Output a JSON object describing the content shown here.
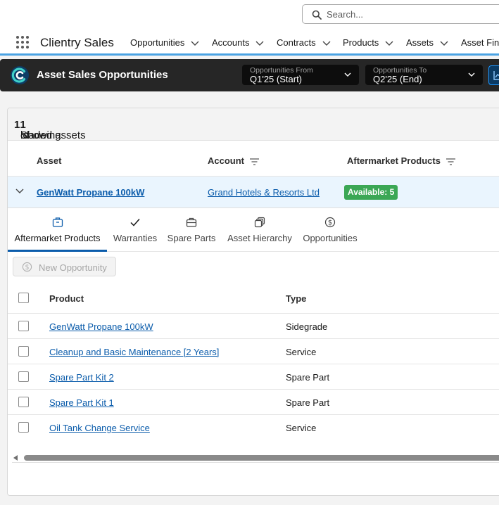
{
  "search": {
    "placeholder": "Search..."
  },
  "app": {
    "name": "Clientry Sales"
  },
  "nav": {
    "items": [
      {
        "label": "Opportunities"
      },
      {
        "label": "Accounts"
      },
      {
        "label": "Contracts"
      },
      {
        "label": "Products"
      },
      {
        "label": "Assets"
      },
      {
        "label": "Asset Finde"
      }
    ]
  },
  "header": {
    "title": "Asset Sales Opportunities",
    "from": {
      "label": "Opportunities From",
      "value": "Q1'25 (Start)"
    },
    "to": {
      "label": "Opportunities To",
      "value": "Q2'25 (End)"
    }
  },
  "summary": {
    "prefix": "Showing ",
    "loaded": "1",
    "middle": " of ",
    "total": "1",
    "suffix": " loaded assets"
  },
  "columns": {
    "asset": "Asset",
    "account": "Account",
    "aftermarket": "Aftermarket Products"
  },
  "asset_row": {
    "asset": "GenWatt Propane 100kW",
    "account": "Grand Hotels & Resorts Ltd",
    "badge": "Available: 5"
  },
  "tabs": [
    {
      "label": "Aftermarket Products",
      "icon": "box-icon"
    },
    {
      "label": "Warranties",
      "icon": "check-icon"
    },
    {
      "label": "Spare Parts",
      "icon": "briefcase-icon"
    },
    {
      "label": "Asset Hierarchy",
      "icon": "hierarchy-icon"
    },
    {
      "label": "Opportunities",
      "icon": "dollar-icon"
    }
  ],
  "new_opportunity": {
    "label": "New Opportunity"
  },
  "products": {
    "headers": {
      "product": "Product",
      "type": "Type"
    },
    "rows": [
      {
        "product": "GenWatt Propane 100kW",
        "type": "Sidegrade"
      },
      {
        "product": "Cleanup and Basic Maintenance [2 Years]",
        "type": "Service"
      },
      {
        "product": "Spare Part Kit 2",
        "type": "Spare Part"
      },
      {
        "product": "Spare Part Kit 1",
        "type": "Spare Part"
      },
      {
        "product": "Oil Tank Change Service",
        "type": "Service"
      }
    ]
  },
  "colors": {
    "accent": "#0b5cab",
    "nav_bar": "#4ba3e3",
    "header_bg": "#262626",
    "badge": "#3ba755",
    "row_highlight": "#eaf5fe"
  }
}
